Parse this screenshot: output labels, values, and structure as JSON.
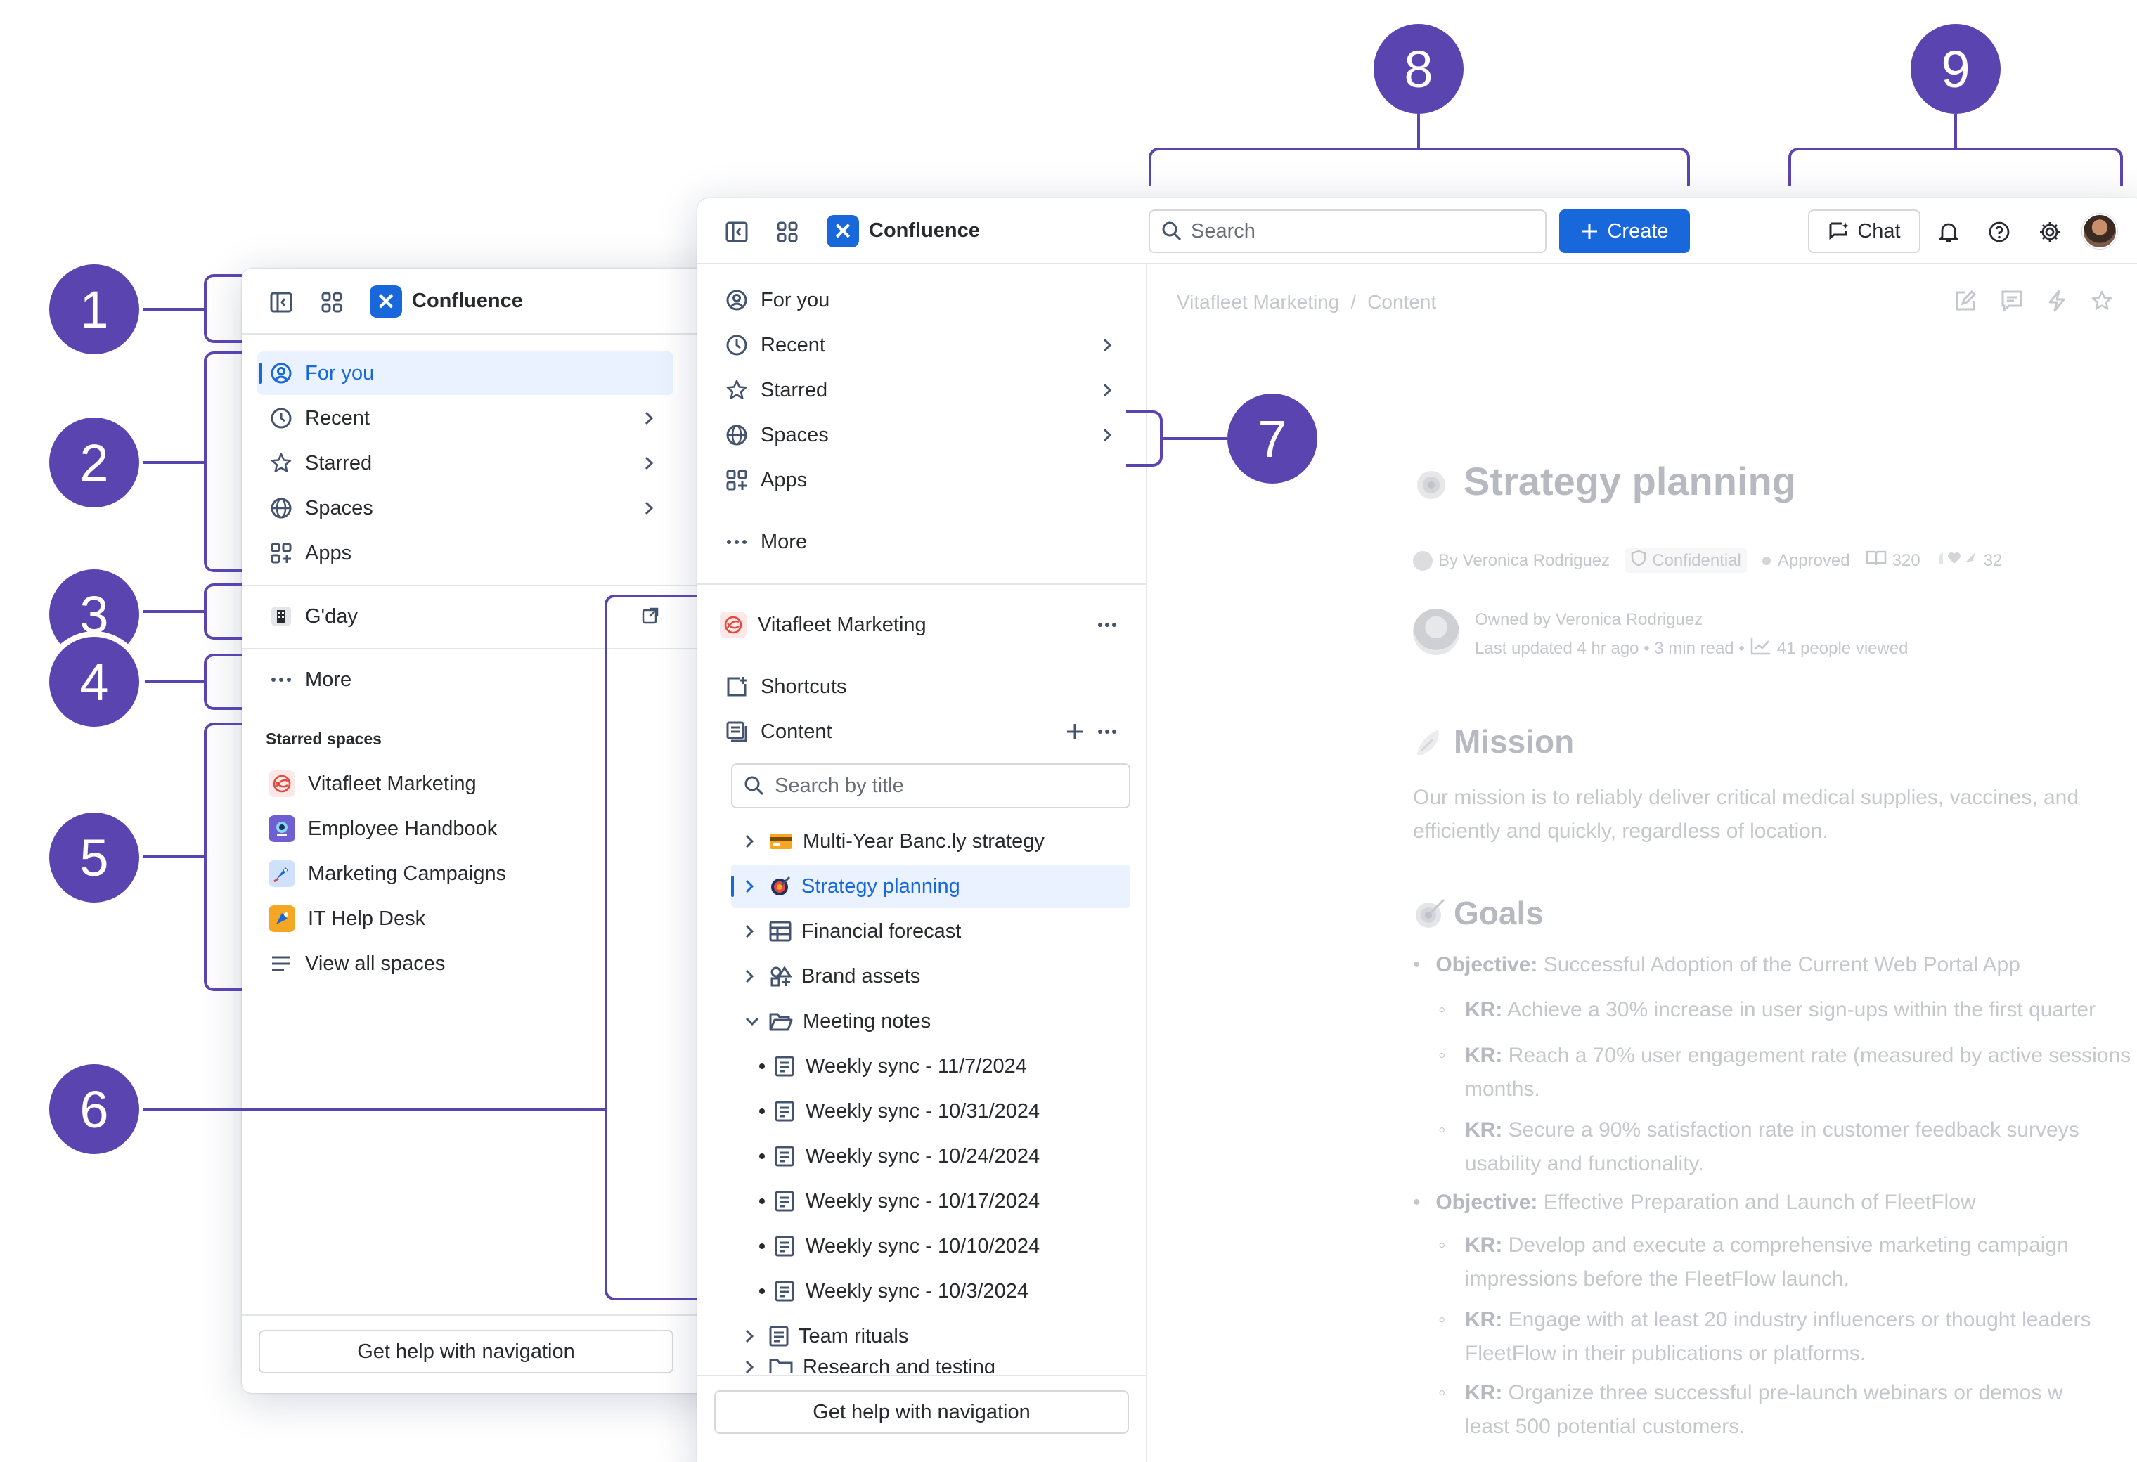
{
  "colors": {
    "accent": "#5a45b0",
    "brand": "#1868db",
    "selected_bg": "#e9f2fe"
  },
  "callouts": [
    "1",
    "2",
    "3",
    "4",
    "5",
    "6",
    "7",
    "8",
    "9"
  ],
  "left_panel": {
    "app_name": "Confluence",
    "nav": [
      {
        "label": "For you",
        "icon": "person-circle-icon"
      },
      {
        "label": "Recent",
        "icon": "clock-icon"
      },
      {
        "label": "Starred",
        "icon": "star-icon"
      },
      {
        "label": "Spaces",
        "icon": "globe-icon"
      },
      {
        "label": "Apps",
        "icon": "apps-grid-icon"
      }
    ],
    "app_link": "G'day",
    "more": "More",
    "starred_title": "Starred spaces",
    "starred": [
      {
        "label": "Vitafleet Marketing",
        "icon": "vitafleet-logo-icon"
      },
      {
        "label": "Employee Handbook",
        "icon": "handbook-logo-icon"
      },
      {
        "label": "Marketing Campaigns",
        "icon": "rocket-icon"
      },
      {
        "label": "IT Help Desk",
        "icon": "helpdesk-logo-icon"
      }
    ],
    "view_all": "View all spaces",
    "help": "Get help with navigation"
  },
  "main": {
    "app_name": "Confluence",
    "search_placeholder": "Search",
    "create": "Create",
    "chat": "Chat",
    "nav": [
      {
        "label": "For you"
      },
      {
        "label": "Recent"
      },
      {
        "label": "Starred"
      },
      {
        "label": "Spaces"
      },
      {
        "label": "Apps"
      }
    ],
    "more": "More",
    "space_name": "Vitafleet Marketing",
    "shortcuts": "Shortcuts",
    "content": "Content",
    "tree_search_placeholder": "Search by title",
    "tree": [
      {
        "label": "Multi-Year Banc.ly strategy"
      },
      {
        "label": "Strategy planning"
      },
      {
        "label": "Financial forecast"
      },
      {
        "label": "Brand assets"
      },
      {
        "label": "Meeting notes"
      },
      {
        "label": "Weekly sync - 11/7/2024"
      },
      {
        "label": "Weekly sync - 10/31/2024"
      },
      {
        "label": "Weekly sync - 10/24/2024"
      },
      {
        "label": "Weekly sync - 10/17/2024"
      },
      {
        "label": "Weekly sync - 10/10/2024"
      },
      {
        "label": "Weekly sync - 10/3/2024"
      },
      {
        "label": "Team rituals"
      },
      {
        "label": "Research and testing"
      }
    ],
    "help": "Get help with navigation"
  },
  "page": {
    "breadcrumb": [
      "Vitafleet Marketing",
      "/",
      "Content"
    ],
    "title": "Strategy planning",
    "byline": "By Veronica Rodriguez",
    "confidential": "Confidential",
    "approved": "Approved",
    "pages_count": "320",
    "reactions_count": "32",
    "owned_by": "Owned by Veronica Rodriguez",
    "updated": "Last updated 4 hr ago • 3 min read •",
    "viewed": "41 people viewed",
    "mission_heading": "Mission",
    "mission_line1": "Our mission is to reliably deliver critical medical supplies, vaccines, and",
    "mission_line2": "efficiently and quickly, regardless of location.",
    "goals_heading": "Goals",
    "obj1_label": "Objective:",
    "obj1_text": " Successful Adoption of the Current Web Portal App",
    "kr_label": "KR:",
    "kr1": " Achieve a 30% increase in user sign-ups within the first quarter",
    "kr2a": " Reach a 70% user engagement rate (measured by active sessions",
    "kr2b": "months.",
    "kr3a": " Secure a 90% satisfaction rate in customer feedback surveys",
    "kr3b": "usability and functionality.",
    "obj2_label": "Objective:",
    "obj2_text": " Effective Preparation and Launch of FleetFlow",
    "kr4a": " Develop and execute a comprehensive marketing campaign",
    "kr4b": "impressions before the FleetFlow launch.",
    "kr5a": " Engage with at least 20 industry influencers or thought leaders",
    "kr5b": "FleetFlow in their publications or platforms.",
    "kr6a": " Organize three successful pre-launch webinars or demos w",
    "kr6b": "least 500 potential customers."
  }
}
